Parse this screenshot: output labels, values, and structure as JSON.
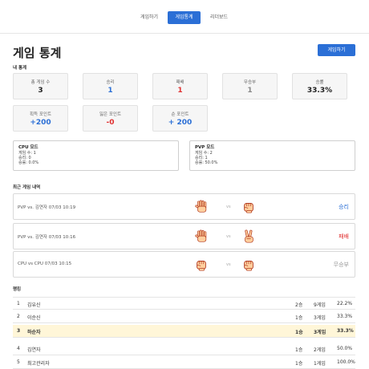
{
  "nav": {
    "tabs": [
      {
        "label": "게임하기"
      },
      {
        "label": "게임통계"
      },
      {
        "label": "리더보드"
      }
    ]
  },
  "page": {
    "title": "게임 통계",
    "play_button": "게임하기"
  },
  "my_stats": {
    "section_title": "내 통계",
    "cards": [
      {
        "label": "총 게임 수",
        "value": "3",
        "color": "#222222"
      },
      {
        "label": "승리",
        "value": "1",
        "color": "#2b6fd6"
      },
      {
        "label": "패배",
        "value": "1",
        "color": "#e03131"
      },
      {
        "label": "무승부",
        "value": "1",
        "color": "#888888"
      },
      {
        "label": "승률",
        "value": "33.3%",
        "color": "#222222"
      },
      {
        "label": "획득 포인트",
        "value": "+200",
        "color": "#2b6fd6"
      },
      {
        "label": "잃은 포인트",
        "value": "-0",
        "color": "#e03131"
      },
      {
        "label": "순 포인트",
        "value": "+ 200",
        "color": "#2b6fd6"
      }
    ]
  },
  "modes": [
    {
      "title": "CPU 모드",
      "games": "게임 수: 1",
      "wins": "승리: 0",
      "rate": "승률: 0.0%"
    },
    {
      "title": "PVP 모드",
      "games": "게임 수: 2",
      "wins": "승리: 1",
      "rate": "승률: 50.0%"
    }
  ],
  "recent": {
    "section_title": "최근 게임 내역",
    "vs_label": "vs",
    "games": [
      {
        "text": "PVP vs. 김연자 07/03 10:19",
        "left_hand": "paper",
        "right_hand": "rock",
        "result": "승리",
        "result_color": "#2b6fd6"
      },
      {
        "text": "PVP vs. 김연자 07/03 10:16",
        "left_hand": "paper",
        "right_hand": "scissors",
        "result": "패배",
        "result_color": "#e03131"
      },
      {
        "text": "CPU vs CPU 07/03 10:15",
        "left_hand": "rock",
        "right_hand": "rock",
        "result": "무승부",
        "result_color": "#999999"
      }
    ]
  },
  "ranking": {
    "section_title": "랭킹",
    "rows": [
      {
        "rank": "1",
        "name": "김유신",
        "wins": "2승",
        "games": "9게임",
        "rate": "22.2%",
        "me": false
      },
      {
        "rank": "2",
        "name": "이순신",
        "wins": "1승",
        "games": "3게임",
        "rate": "33.3%",
        "me": false
      },
      {
        "rank": "3",
        "name": "하순자",
        "wins": "1승",
        "games": "3게임",
        "rate": "33.3%",
        "me": true
      },
      {
        "rank": "4",
        "name": "김연자",
        "wins": "1승",
        "games": "2게임",
        "rate": "50.0%",
        "me": false
      },
      {
        "rank": "5",
        "name": "최고관리자",
        "wins": "1승",
        "games": "1게임",
        "rate": "100.0%",
        "me": false
      }
    ]
  }
}
